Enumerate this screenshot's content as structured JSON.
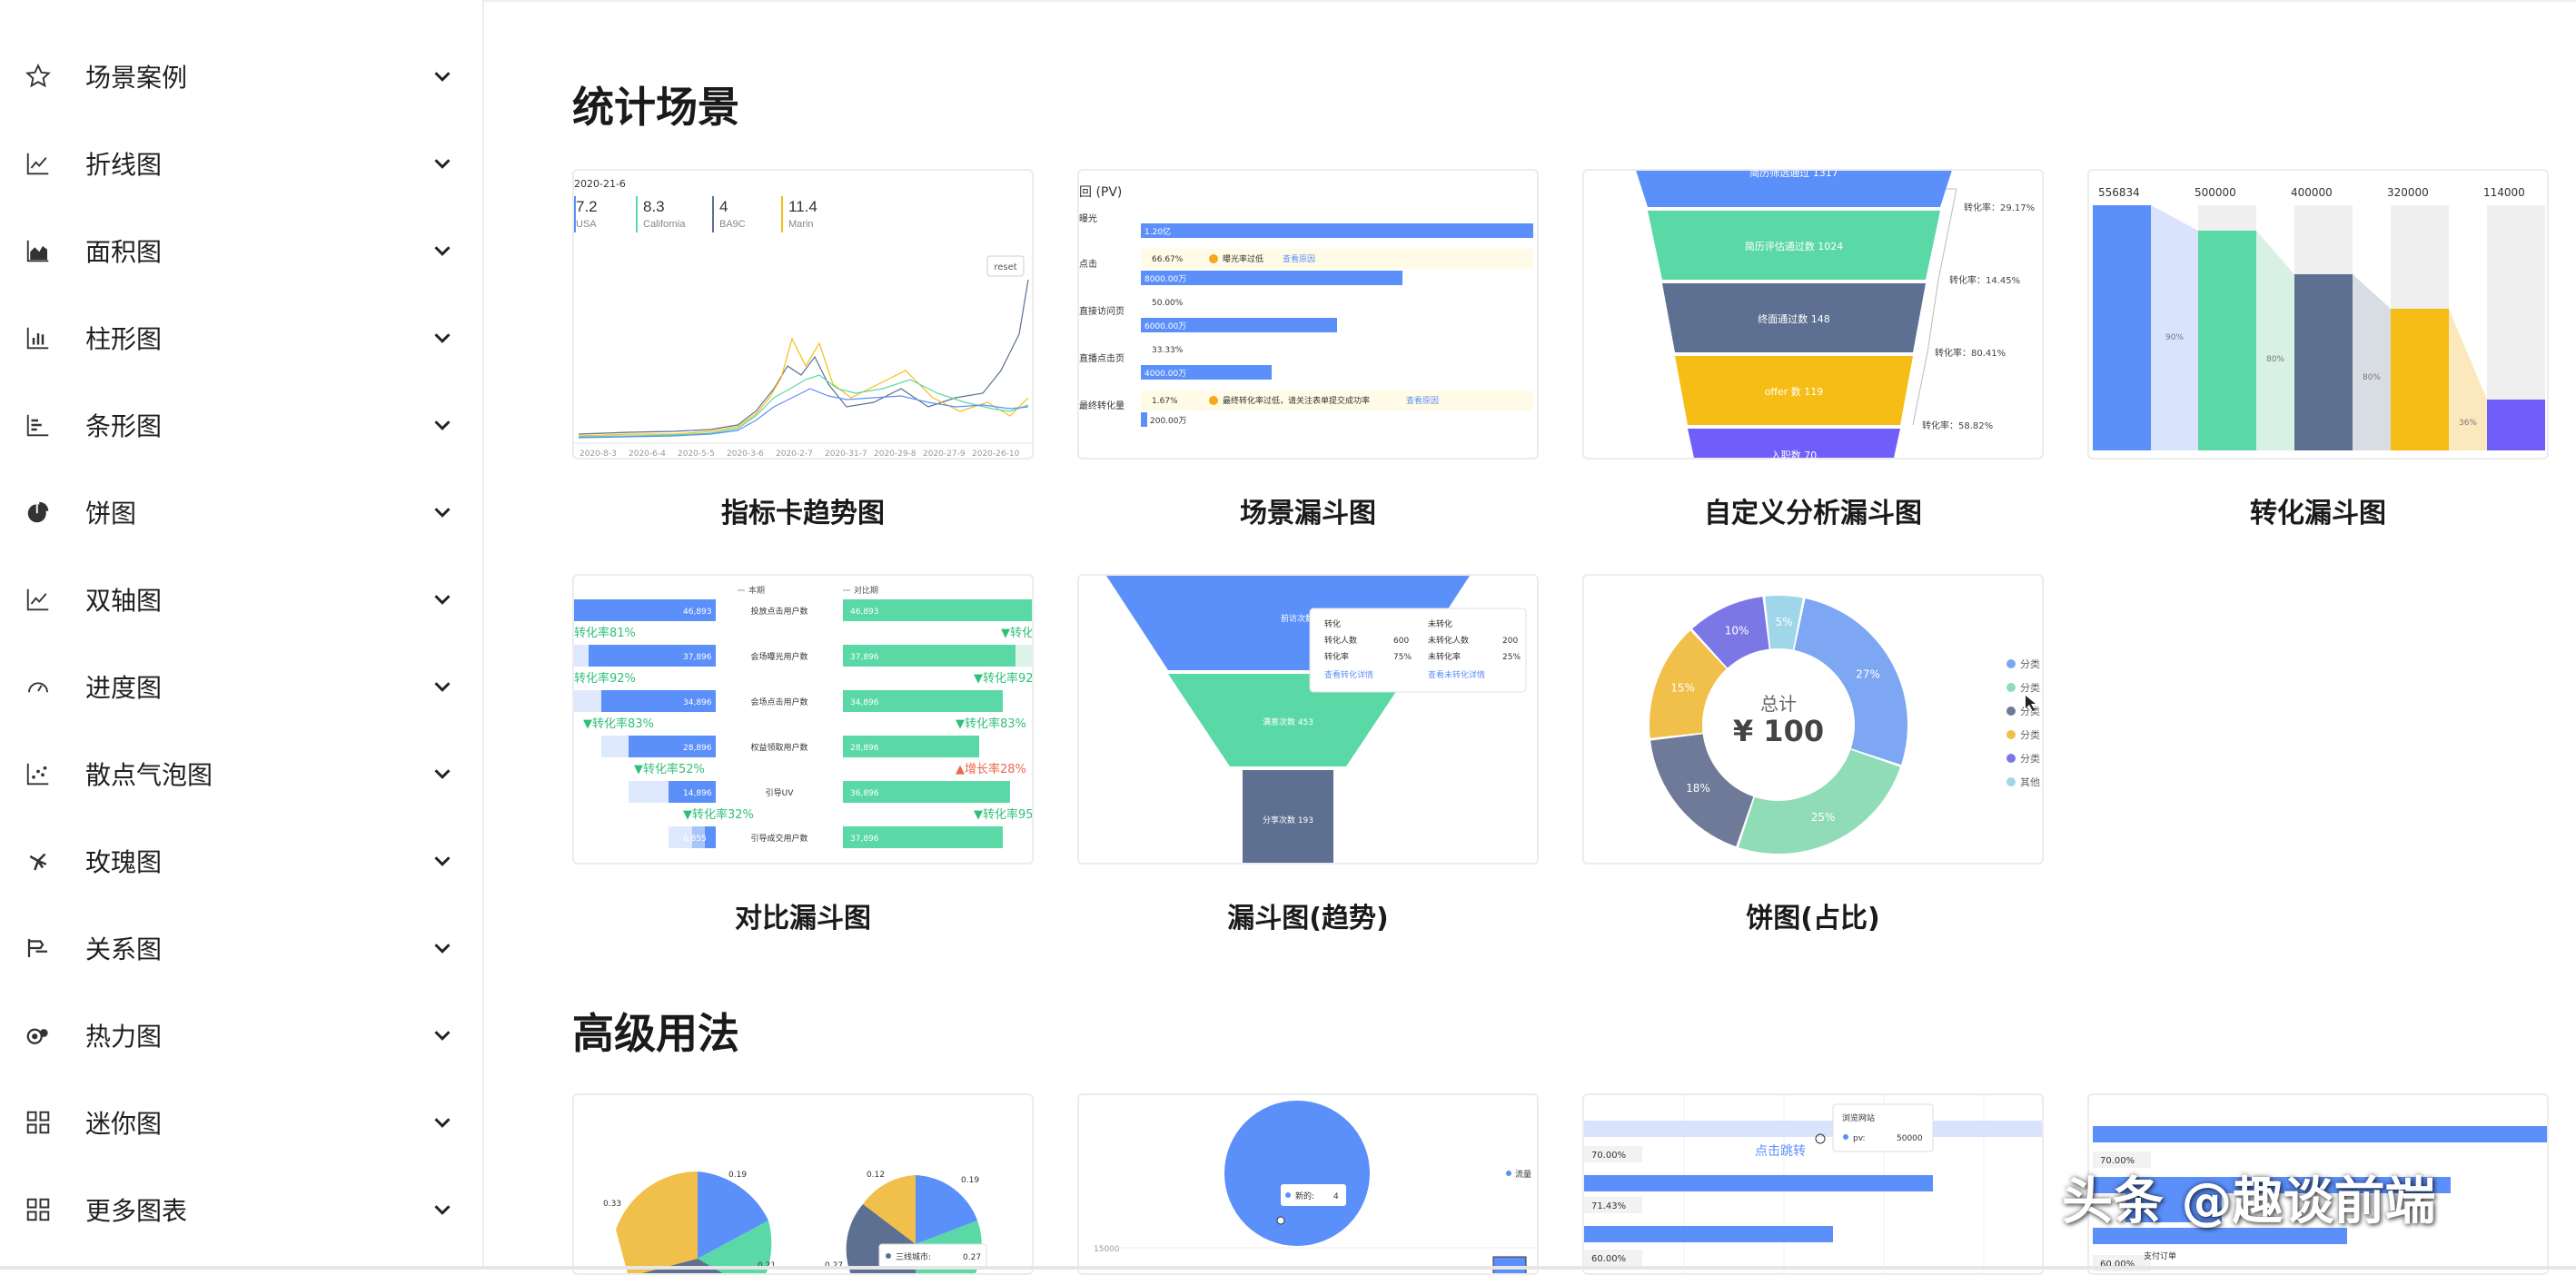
{
  "sidebar": {
    "items": [
      {
        "label": "场景案例",
        "icon": "star-icon"
      },
      {
        "label": "折线图",
        "icon": "line-chart-icon"
      },
      {
        "label": "面积图",
        "icon": "area-chart-icon"
      },
      {
        "label": "柱形图",
        "icon": "column-chart-icon"
      },
      {
        "label": "条形图",
        "icon": "bar-chart-icon"
      },
      {
        "label": "饼图",
        "icon": "pie-chart-icon"
      },
      {
        "label": "双轴图",
        "icon": "dual-axis-icon"
      },
      {
        "label": "进度图",
        "icon": "gauge-icon"
      },
      {
        "label": "散点气泡图",
        "icon": "scatter-icon"
      },
      {
        "label": "玫瑰图",
        "icon": "rose-icon"
      },
      {
        "label": "关系图",
        "icon": "relation-icon"
      },
      {
        "label": "热力图",
        "icon": "heatmap-icon"
      },
      {
        "label": "迷你图",
        "icon": "grid-icon"
      },
      {
        "label": "更多图表",
        "icon": "grid-icon"
      }
    ]
  },
  "main": {
    "section1_title": "统计场景",
    "section2_title": "高级用法",
    "cards": [
      {
        "title": "指标卡趋势图"
      },
      {
        "title": "场景漏斗图"
      },
      {
        "title": "自定义分析漏斗图"
      },
      {
        "title": "转化漏斗图"
      },
      {
        "title": "对比漏斗图"
      },
      {
        "title": "漏斗图(趋势)"
      },
      {
        "title": "饼图(占比)"
      }
    ]
  },
  "thumbs": {
    "trend": {
      "date": "2020-21-6",
      "metrics": [
        {
          "value": "7.2",
          "name": "USA",
          "color": "#5b8ff9"
        },
        {
          "value": "8.3",
          "name": "California",
          "color": "#5ad8a6"
        },
        {
          "value": "4",
          "name": "BA9C",
          "color": "#5d7092"
        },
        {
          "value": "11.4",
          "name": "Marin",
          "color": "#f6bd16"
        }
      ],
      "reset": "reset",
      "xticks": [
        "2020-8-3",
        "2020-6-4",
        "2020-5-5",
        "2020-3-6",
        "2020-2-7",
        "2020-31-7",
        "2020-29-8",
        "2020-27-9",
        "2020-26-10"
      ]
    },
    "scene_funnel": {
      "title": "曝光",
      "title_full": "回 (PV)",
      "rows": [
        {
          "label": "曝光",
          "bar": "1.20亿"
        },
        {
          "label": "点击",
          "pct": "66.67%",
          "warn": "曝光率过低",
          "link": "查看原因"
        },
        {
          "bar": "8000.00万"
        },
        {
          "label": "直接访问页",
          "pct": "50.00%"
        },
        {
          "bar": "6000.00万"
        },
        {
          "label": "直播点击页",
          "pct": "33.33%"
        },
        {
          "bar": "4000.00万"
        },
        {
          "label": "最终转化量",
          "pct": "1.67%",
          "warn": "最终转化率过低，请关注表单提交成功率",
          "link": "查看原因"
        },
        {
          "bar": "200.00万"
        }
      ]
    },
    "custom_funnel": {
      "layers": [
        "简历筛选通过 1317",
        "简历评估通过数 1024",
        "终面通过数 148",
        "offer 数 119",
        "入职数 70"
      ],
      "rates": [
        "转化率：29.17%",
        "转化率：14.45%",
        "转化率：80.41%",
        "转化率：58.82%"
      ]
    },
    "conversion_funnel": {
      "values": [
        "556834",
        "500000",
        "400000",
        "320000",
        "114000"
      ],
      "rates": [
        "90%",
        "80%",
        "80%",
        "36%"
      ]
    },
    "compare_funnel": {
      "legend_current": "本期",
      "legend_prev": "对比期",
      "rows": [
        {
          "label": "投放点击用户数",
          "left": "46,893",
          "right": "46,893"
        },
        {
          "label": "会场曝光用户数",
          "left": "37,896",
          "right": "37,896"
        },
        {
          "label": "会场点击用户数",
          "left": "34,896",
          "right": "34,896"
        },
        {
          "label": "权益领取用户数",
          "left": "28,896",
          "right": "28,896"
        },
        {
          "label": "引导UV",
          "left": "14,896",
          "right": "36,896"
        },
        {
          "label": "引导成交用户数",
          "left": "6,855",
          "right": "37,896"
        }
      ],
      "left_rates": [
        "转化率81%",
        "转化率92%",
        "▼转化率83%",
        "▼转化率52%",
        "▼转化率32%"
      ],
      "right_rates": [
        "▼转化",
        "▼转化率92",
        "▼转化率83%",
        "▲增长率28%",
        "▼转化率95"
      ]
    },
    "trend_funnel": {
      "layers": [
        "前访次数 780",
        "满意次数 453",
        "分享次数 193"
      ],
      "tooltip": {
        "col1_title": "转化",
        "col2_title": "未转化",
        "row1": [
          "转化人数",
          "600",
          "未转化人数",
          "200"
        ],
        "row2": [
          "转化率",
          "75%",
          "未转化率",
          "25%"
        ],
        "link1": "查看转化详情",
        "link2": "查看未转化详情"
      }
    },
    "pie_ratio": {
      "center_label": "总计",
      "center_value": "¥ 100",
      "slices": [
        {
          "label": "27%",
          "value": 27,
          "color": "#7ea7f3"
        },
        {
          "label": "25%",
          "value": 25,
          "color": "#8fdcb6"
        },
        {
          "label": "18%",
          "value": 18,
          "color": "#6e7a97"
        },
        {
          "label": "15%",
          "value": 15,
          "color": "#f0c04a"
        },
        {
          "label": "10%",
          "value": 10,
          "color": "#7b78e6"
        },
        {
          "label": "5%",
          "value": 5,
          "color": "#9fd6ea"
        }
      ],
      "legend": [
        "分类",
        "分类",
        "分类",
        "分类",
        "分类",
        "其他"
      ]
    },
    "adv1": {
      "labels": [
        "0.19",
        "0.33",
        "0.21",
        "0.12",
        "0.19",
        "0.27"
      ],
      "tooltip": "三线城市:",
      "tooltip_val": "0.27"
    },
    "adv2": {
      "tooltip": "新的:",
      "tooltip_val": "4",
      "axis": "15000"
    },
    "adv3": {
      "tooltip_title": "浏览网站",
      "tooltip_key": "pv:",
      "tooltip_val": "50000",
      "link": "点击跳转",
      "pcts": [
        "70.00%",
        "71.43%",
        "60.00%"
      ]
    },
    "adv4": {
      "pcts": [
        "70.00%",
        "60.00%"
      ],
      "label": "支付订单"
    }
  },
  "watermark": "头条 @趣谈前端",
  "colors": {
    "blue": "#5b8ff9",
    "green": "#5ad8a6",
    "slate": "#5d7092",
    "yellow": "#f6bd16",
    "purple": "#6f5ef9",
    "sky": "#6dc8ec"
  }
}
